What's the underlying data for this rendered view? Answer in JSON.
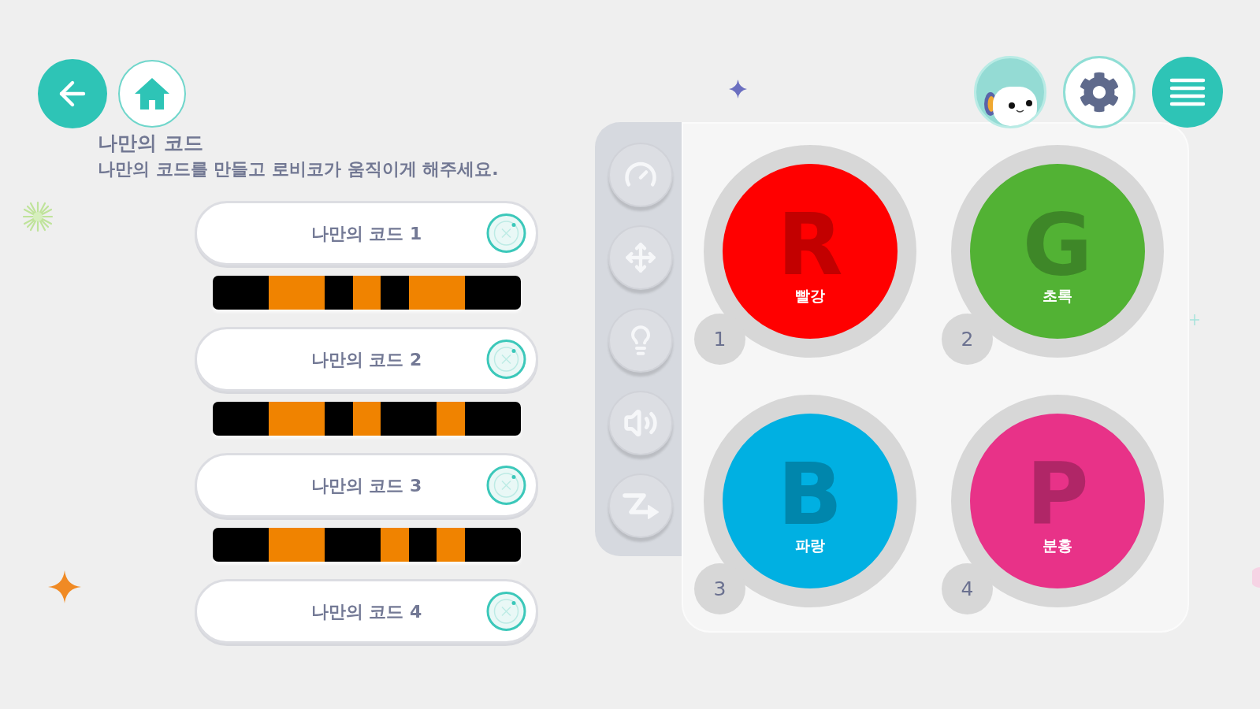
{
  "header": {
    "title": "나만의 코드",
    "subtitle": "나만의 코드를 만들고 로비코가 움직이게 해주세요."
  },
  "codes": [
    {
      "label": "나만의 코드 1",
      "cells": [
        {
          "on": false
        },
        {
          "on": false
        },
        {
          "on": true
        },
        {
          "on": true
        },
        {
          "on": false
        },
        {
          "on": true
        },
        {
          "on": false
        },
        {
          "on": true
        },
        {
          "on": true
        },
        {
          "on": false
        },
        {
          "on": false
        }
      ]
    },
    {
      "label": "나만의 코드 2",
      "cells": [
        {
          "on": false
        },
        {
          "on": false
        },
        {
          "on": true
        },
        {
          "on": true
        },
        {
          "on": false
        },
        {
          "on": true
        },
        {
          "on": false
        },
        {
          "on": false
        },
        {
          "on": true
        },
        {
          "on": false
        },
        {
          "on": false
        }
      ]
    },
    {
      "label": "나만의 코드 3",
      "cells": [
        {
          "on": false
        },
        {
          "on": false
        },
        {
          "on": true
        },
        {
          "on": true
        },
        {
          "on": false
        },
        {
          "on": false
        },
        {
          "on": true
        },
        {
          "on": false
        },
        {
          "on": true
        },
        {
          "on": false
        },
        {
          "on": false
        }
      ]
    },
    {
      "label": "나만의 코드 4"
    }
  ],
  "colors": [
    {
      "number": "1",
      "letter": "R",
      "label": "빨강",
      "color": "#ff0000"
    },
    {
      "number": "2",
      "letter": "G",
      "label": "초록",
      "color": "#52b234"
    },
    {
      "number": "3",
      "letter": "B",
      "label": "파랑",
      "color": "#00b0e2"
    },
    {
      "number": "4",
      "letter": "P",
      "label": "분홍",
      "color": "#e83288"
    }
  ]
}
